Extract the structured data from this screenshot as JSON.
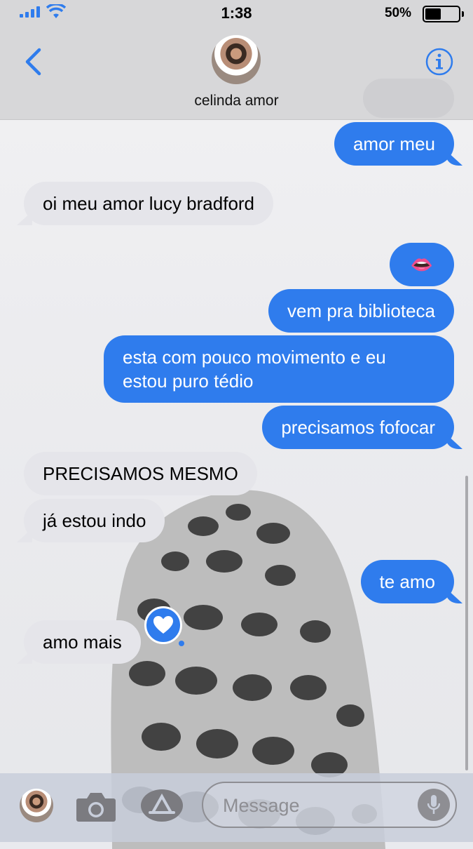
{
  "status_bar": {
    "time": "1:38",
    "battery_percent": "50%",
    "icons": [
      "cellular-signal-icon",
      "wifi-icon",
      "battery-icon"
    ]
  },
  "header": {
    "contact_name": "celinda amor",
    "icons": [
      "back-chevron-icon",
      "info-icon"
    ]
  },
  "messages": [
    {
      "from": "me",
      "text": "amor meu"
    },
    {
      "from": "them",
      "text": "oi meu amor lucy bradford"
    },
    {
      "from": "me",
      "text": "👄"
    },
    {
      "from": "me",
      "text": "vem pra biblioteca"
    },
    {
      "from": "me",
      "text": "esta com pouco movimento e eu estou puro tédio"
    },
    {
      "from": "me",
      "text": "precisamos fofocar"
    },
    {
      "from": "them",
      "text": "PRECISAMOS MESMO"
    },
    {
      "from": "them",
      "text": "já estou indo"
    },
    {
      "from": "me",
      "text": "te amo"
    },
    {
      "from": "them",
      "text": "amo mais",
      "tapback": "heart"
    }
  ],
  "input_bar": {
    "placeholder": "Message",
    "icons": [
      "avatar",
      "camera-icon",
      "app-store-icon",
      "microphone-icon"
    ]
  },
  "colors": {
    "outgoing_bubble": "#2f7ced",
    "incoming_bubble": "#e5e5ea",
    "accent": "#2f7ced"
  }
}
